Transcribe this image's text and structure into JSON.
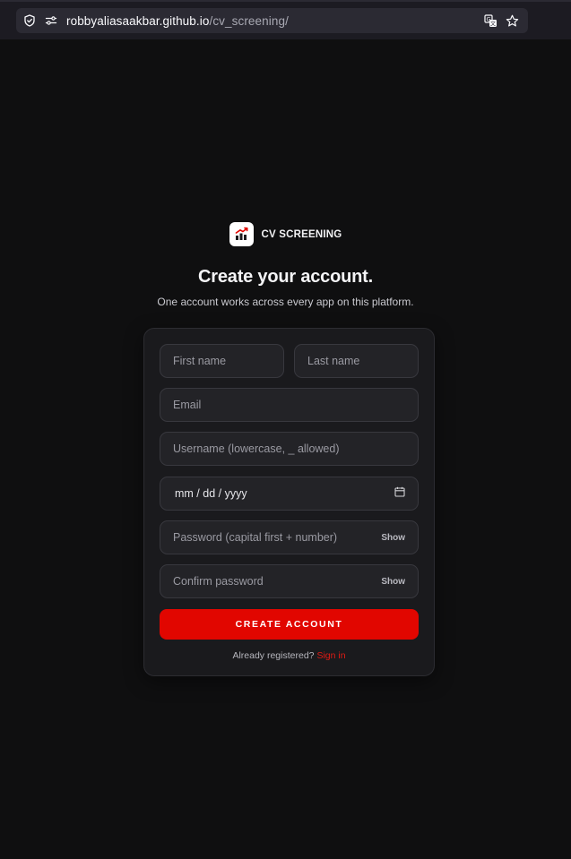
{
  "browser": {
    "url_host": "robbyaliasaakbar.github.io",
    "url_path": "/cv_screening/"
  },
  "brand": {
    "name": "CV SCREENING"
  },
  "header": {
    "title": "Create your account.",
    "subtitle": "One account works across every app on this platform."
  },
  "form": {
    "first_name_placeholder": "First name",
    "last_name_placeholder": "Last name",
    "email_placeholder": "Email",
    "username_placeholder": "Username (lowercase, _ allowed)",
    "birthdate_value": "mm / dd / yyyy",
    "password_placeholder": "Password (capital first + number)",
    "password_toggle": "Show",
    "confirm_placeholder": "Confirm password",
    "confirm_toggle": "Show",
    "submit_label": "CREATE ACCOUNT",
    "signin_prompt": "Already registered?",
    "signin_link": "Sign in"
  },
  "colors": {
    "accent": "#e10600",
    "background": "#0f0f10",
    "card": "#1a1a1d",
    "field": "#232327"
  }
}
